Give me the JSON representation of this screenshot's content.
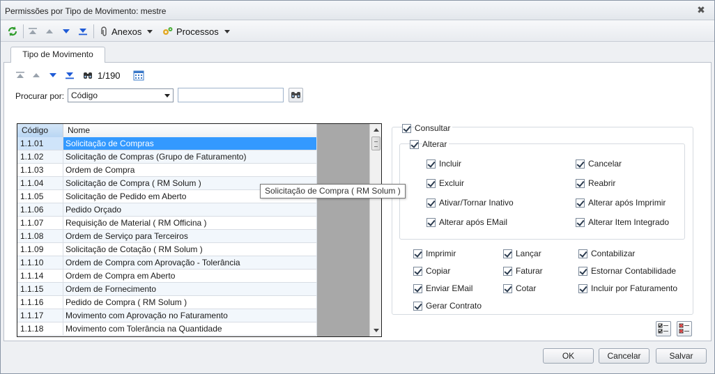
{
  "window": {
    "title": "Permissões por Tipo de Movimento: mestre"
  },
  "toolbar": {
    "anexos_label": "Anexos",
    "processos_label": "Processos"
  },
  "tab": {
    "label": "Tipo de Movimento"
  },
  "navigator": {
    "counter": "1/190"
  },
  "search": {
    "label": "Procurar por:",
    "field": "Código",
    "value": ""
  },
  "grid": {
    "columns": [
      "Código",
      "Nome"
    ],
    "rows": [
      {
        "codigo": "1.1.01",
        "nome": "Solicitação de Compras"
      },
      {
        "codigo": "1.1.02",
        "nome": "Solicitação de Compras (Grupo de Faturamento)"
      },
      {
        "codigo": "1.1.03",
        "nome": "Ordem de Compra"
      },
      {
        "codigo": "1.1.04",
        "nome": "Solicitação de Compra  ( RM Solum )"
      },
      {
        "codigo": "1.1.05",
        "nome": "Solicitação de Pedido em Aberto"
      },
      {
        "codigo": "1.1.06",
        "nome": "Pedido Orçado"
      },
      {
        "codigo": "1.1.07",
        "nome": "Requisição de Material ( RM Officina )"
      },
      {
        "codigo": "1.1.08",
        "nome": "Ordem de Serviço para Terceiros"
      },
      {
        "codigo": "1.1.09",
        "nome": "Solicitação de Cotação  ( RM Solum )"
      },
      {
        "codigo": "1.1.10",
        "nome": "Ordem de Compra com Aprovação - Tolerância"
      },
      {
        "codigo": "1.1.14",
        "nome": "Ordem de Compra em Aberto"
      },
      {
        "codigo": "1.1.15",
        "nome": "Ordem de Fornecimento"
      },
      {
        "codigo": "1.1.16",
        "nome": "Pedido de Compra  ( RM Solum )"
      },
      {
        "codigo": "1.1.17",
        "nome": "Movimento com Aprovação no Faturamento"
      },
      {
        "codigo": "1.1.18",
        "nome": "Movimento com Tolerância na Quantidade"
      }
    ]
  },
  "tooltip": {
    "text": "Solicitação de Compra  ( RM Solum )"
  },
  "permissions": {
    "consultar": "Consultar",
    "alterar": "Alterar",
    "incluir": "Incluir",
    "cancelar": "Cancelar",
    "excluir": "Excluir",
    "reabrir": "Reabrir",
    "ativar_inativo": "Ativar/Tornar Inativo",
    "alterar_apos_imprimir": "Alterar após Imprimir",
    "alterar_apos_email": "Alterar após EMail",
    "alterar_item_integrado": "Alterar Item Integrado",
    "imprimir": "Imprimir",
    "lancar": "Lançar",
    "contabilizar": "Contabilizar",
    "copiar": "Copiar",
    "faturar": "Faturar",
    "estornar_contabilidade": "Estornar Contabilidade",
    "enviar_email": "Enviar EMail",
    "cotar": "Cotar",
    "incluir_por_faturamento": "Incluir por Faturamento",
    "gerar_contrato": "Gerar Contrato"
  },
  "footer": {
    "ok": "OK",
    "cancelar": "Cancelar",
    "salvar": "Salvar"
  }
}
